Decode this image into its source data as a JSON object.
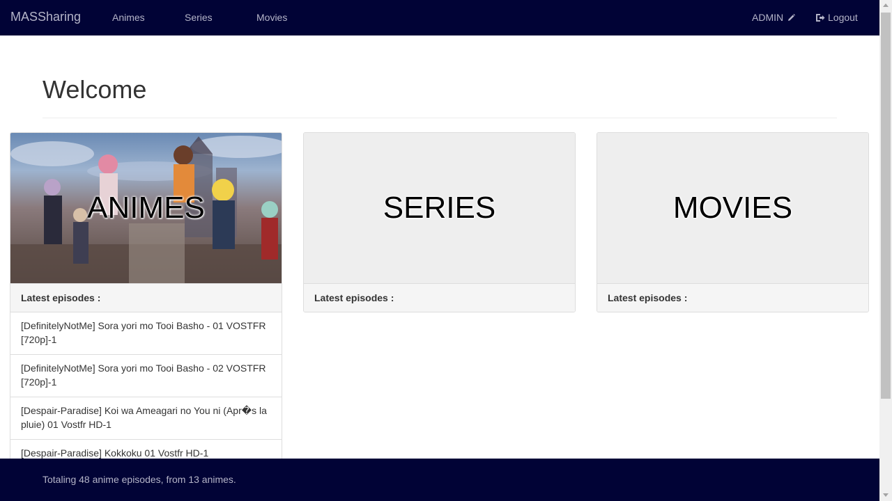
{
  "navbar": {
    "brand": "MASSharing",
    "links": [
      "Animes",
      "Series",
      "Movies"
    ],
    "user": "ADMIN",
    "logout": "Logout",
    "colors": {
      "background": "#010336",
      "text": "#b4b4c8"
    }
  },
  "main": {
    "title": "Welcome",
    "panels": [
      {
        "cover_title": "ANIMES",
        "heading": "Latest episodes :",
        "episodes": [
          "[DefinitelyNotMe] Sora yori mo Tooi Basho - 01 VOSTFR [720p]-1",
          "[DefinitelyNotMe] Sora yori mo Tooi Basho - 02 VOSTFR [720p]-1",
          "[Despair-Paradise] Koi wa Ameagari no You ni (Apr�s la pluie) 01 Vostfr HD-1",
          "[Despair-Paradise] Kokkoku 01 Vostfr HD-1"
        ]
      },
      {
        "cover_title": "SERIES",
        "heading": "Latest episodes :"
      },
      {
        "cover_title": "MOVIES",
        "heading": "Latest episodes :"
      }
    ]
  },
  "footer": {
    "text": "Totaling 48 anime episodes, from 13 animes."
  }
}
